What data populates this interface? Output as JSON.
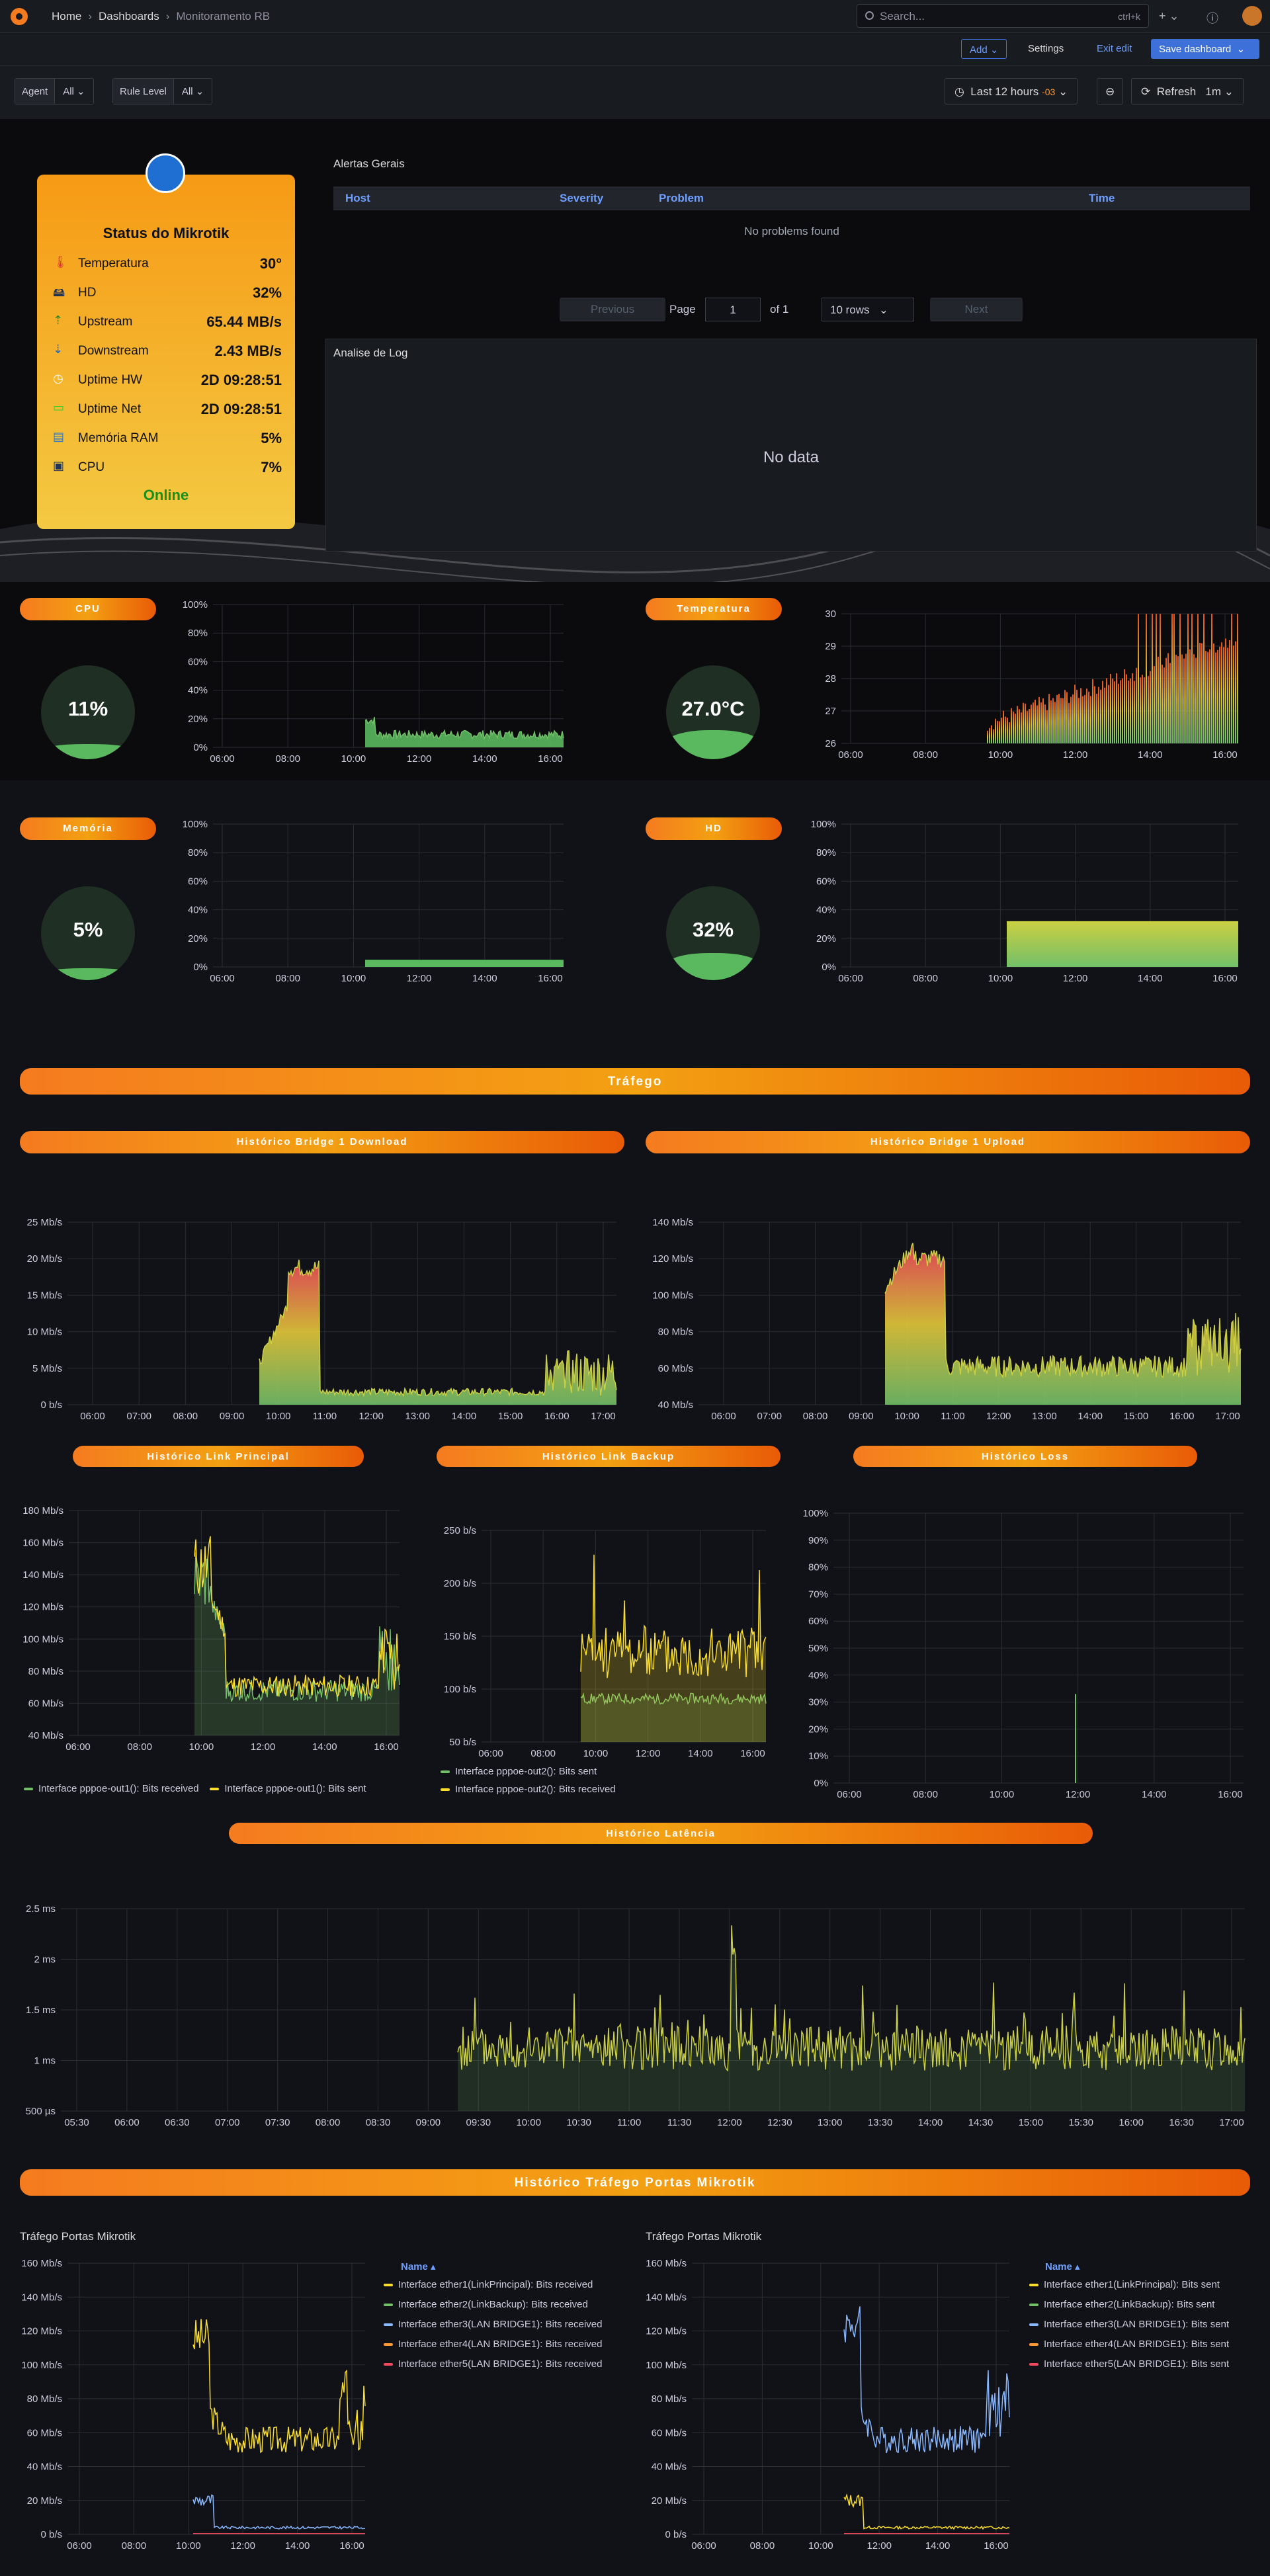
{
  "topbar": {
    "crumbs": [
      "Home",
      "Dashboards",
      "Monitoramento RB"
    ],
    "search_placeholder": "Search...",
    "search_shortcut": "ctrl+k"
  },
  "toolbar": {
    "add": "Add",
    "settings": "Settings",
    "exit_edit": "Exit edit",
    "save": "Save dashboard"
  },
  "vars": [
    {
      "label": "Agent",
      "value": "All"
    },
    {
      "label": "Rule Level",
      "value": "All"
    }
  ],
  "time": {
    "range": "Last 12 hours",
    "tz": "-03",
    "refresh": "Refresh",
    "interval": "1m"
  },
  "mikrotik": {
    "title": "Status do Mikrotik",
    "status": "Online",
    "rows": [
      {
        "key": "Temperatura",
        "value": "30°",
        "icon": "thermometer-icon"
      },
      {
        "key": "HD",
        "value": "32%",
        "icon": "disk-icon"
      },
      {
        "key": "Upstream",
        "value": "65.44 MB/s",
        "icon": "upload-icon"
      },
      {
        "key": "Downstream",
        "value": "2.43 MB/s",
        "icon": "download-icon"
      },
      {
        "key": "Uptime HW",
        "value": "2D 09:28:51",
        "icon": "clock-icon"
      },
      {
        "key": "Uptime Net",
        "value": "2D 09:28:51",
        "icon": "battery-icon"
      },
      {
        "key": "Memória RAM",
        "value": "5%",
        "icon": "memory-icon"
      },
      {
        "key": "CPU",
        "value": "7%",
        "icon": "cpu-icon"
      }
    ]
  },
  "alerts": {
    "title": "Alertas Gerais",
    "columns": [
      "Host",
      "Severity",
      "Problem",
      "Time"
    ],
    "empty": "No problems found",
    "prev": "Previous",
    "page_label": "Page",
    "page": "1",
    "of": "of 1",
    "rows": "10 rows",
    "next": "Next"
  },
  "log": {
    "title": "Analise de Log",
    "empty": "No data"
  },
  "pills": {
    "cpu": "CPU",
    "temp": "Temperatura",
    "mem": "Memória",
    "hd": "HD",
    "trafego": "Tráfego",
    "bridge_down": "Histórico Bridge 1 Download",
    "bridge_up": "Histórico Bridge 1 Upload",
    "link_principal": "Histórico Link Principal",
    "link_backup": "Histórico Link Backup",
    "loss": "Histórico Loss",
    "latencia": "Histórico Latência",
    "portas": "Histórico Tráfego Portas Mikrotik"
  },
  "gauges": {
    "cpu": "11%",
    "temp": "27.0°C",
    "mem": "5%",
    "hd": "32%",
    "cpu_level": 11,
    "temp_level": 35,
    "mem_level": 5,
    "hd_level": 32
  },
  "ports": {
    "title_left": "Tráfego Portas Mikrotik",
    "title_right": "Tráfego Portas Mikrotik",
    "name_header": "Name",
    "left": [
      "Interface ether1(LinkPrincipal): Bits received",
      "Interface ether2(LinkBackup): Bits received",
      "Interface ether3(LAN BRIDGE1): Bits received",
      "Interface ether4(LAN BRIDGE1): Bits received",
      "Interface ether5(LAN BRIDGE1): Bits received"
    ],
    "right": [
      "Interface ether1(LinkPrincipal): Bits sent",
      "Interface ether2(LinkBackup): Bits sent",
      "Interface ether3(LAN BRIDGE1): Bits sent",
      "Interface ether4(LAN BRIDGE1): Bits sent",
      "Interface ether5(LAN BRIDGE1): Bits sent"
    ],
    "colors": [
      "#fade2a",
      "#73bf69",
      "#8ab8ff",
      "#ff9830",
      "#f2495c"
    ]
  },
  "legends": {
    "link_principal": [
      "Interface pppoe-out1(): Bits received",
      "Interface pppoe-out1(): Bits sent"
    ],
    "link_backup": [
      "Interface pppoe-out2(): Bits sent",
      "Interface pppoe-out2(): Bits received"
    ]
  },
  "chart_data": [
    {
      "id": "cpu",
      "type": "area",
      "yticks": [
        "100%",
        "80%",
        "60%",
        "40%",
        "20%",
        "0%"
      ],
      "xticks": [
        "06:00",
        "08:00",
        "10:00",
        "12:00",
        "14:00",
        "16:00"
      ],
      "ylim": [
        0,
        100
      ],
      "x_start_frac": 0.48,
      "base": 9,
      "amp": 3
    },
    {
      "id": "temp",
      "type": "bar",
      "yticks": [
        "30",
        "29",
        "28",
        "27",
        "26"
      ],
      "xticks": [
        "06:00",
        "08:00",
        "10:00",
        "12:00",
        "14:00",
        "16:00"
      ],
      "ylim": [
        25.5,
        30
      ]
    },
    {
      "id": "mem",
      "type": "area",
      "yticks": [
        "100%",
        "80%",
        "60%",
        "40%",
        "20%",
        "0%"
      ],
      "xticks": [
        "06:00",
        "08:00",
        "10:00",
        "12:00",
        "14:00",
        "16:00"
      ],
      "ylim": [
        0,
        100
      ],
      "value": 5
    },
    {
      "id": "hd",
      "type": "area",
      "yticks": [
        "100%",
        "80%",
        "60%",
        "40%",
        "20%",
        "0%"
      ],
      "xticks": [
        "06:00",
        "08:00",
        "10:00",
        "12:00",
        "14:00",
        "16:00"
      ],
      "ylim": [
        0,
        100
      ],
      "value": 32
    },
    {
      "id": "bdown",
      "type": "area",
      "yticks": [
        "25 Mb/s",
        "20 Mb/s",
        "15 Mb/s",
        "10 Mb/s",
        "5 Mb/s",
        "0 b/s"
      ],
      "xticks": [
        "06:00",
        "07:00",
        "08:00",
        "09:00",
        "10:00",
        "11:00",
        "12:00",
        "13:00",
        "14:00",
        "15:00",
        "16:00",
        "17:00"
      ],
      "ylim": [
        0,
        27
      ]
    },
    {
      "id": "bup",
      "type": "area",
      "yticks": [
        "140 Mb/s",
        "120 Mb/s",
        "100 Mb/s",
        "80 Mb/s",
        "60 Mb/s",
        "40 Mb/s"
      ],
      "xticks": [
        "06:00",
        "07:00",
        "08:00",
        "09:00",
        "10:00",
        "11:00",
        "12:00",
        "13:00",
        "14:00",
        "15:00",
        "16:00",
        "17:00"
      ],
      "ylim": [
        35,
        150
      ]
    },
    {
      "id": "lprin",
      "type": "line",
      "yticks": [
        "180 Mb/s",
        "160 Mb/s",
        "140 Mb/s",
        "120 Mb/s",
        "100 Mb/s",
        "80 Mb/s",
        "60 Mb/s",
        "40 Mb/s"
      ],
      "xticks": [
        "06:00",
        "08:00",
        "10:00",
        "12:00",
        "14:00",
        "16:00"
      ],
      "ylim": [
        35,
        185
      ]
    },
    {
      "id": "lback",
      "type": "line",
      "yticks": [
        "250 b/s",
        "200 b/s",
        "150 b/s",
        "100 b/s",
        "50 b/s"
      ],
      "xticks": [
        "06:00",
        "08:00",
        "10:00",
        "12:00",
        "14:00",
        "16:00"
      ],
      "ylim": [
        20,
        275
      ]
    },
    {
      "id": "loss",
      "type": "line",
      "yticks": [
        "100%",
        "90%",
        "80%",
        "70%",
        "60%",
        "50%",
        "40%",
        "30%",
        "20%",
        "10%",
        "0%"
      ],
      "xticks": [
        "06:00",
        "08:00",
        "10:00",
        "12:00",
        "14:00",
        "16:00"
      ],
      "ylim": [
        0,
        100
      ]
    },
    {
      "id": "lat",
      "type": "line",
      "yticks": [
        "2.5 ms",
        "2 ms",
        "1.5 ms",
        "1 ms",
        "500 µs"
      ],
      "xticks": [
        "05:30",
        "06:00",
        "06:30",
        "07:00",
        "07:30",
        "08:00",
        "08:30",
        "09:00",
        "09:30",
        "10:00",
        "10:30",
        "11:00",
        "11:30",
        "12:00",
        "12:30",
        "13:00",
        "13:30",
        "14:00",
        "14:30",
        "15:00",
        "15:30",
        "16:00",
        "16:30",
        "17:00"
      ],
      "ylim": [
        0.3,
        2.65
      ]
    },
    {
      "id": "portL",
      "type": "line",
      "yticks": [
        "160 Mb/s",
        "140 Mb/s",
        "120 Mb/s",
        "100 Mb/s",
        "80 Mb/s",
        "60 Mb/s",
        "40 Mb/s",
        "20 Mb/s",
        "0 b/s"
      ],
      "xticks": [
        "06:00",
        "08:00",
        "10:00",
        "12:00",
        "14:00",
        "16:00"
      ],
      "ylim": [
        0,
        160
      ]
    },
    {
      "id": "portR",
      "type": "line",
      "yticks": [
        "160 Mb/s",
        "140 Mb/s",
        "120 Mb/s",
        "100 Mb/s",
        "80 Mb/s",
        "60 Mb/s",
        "40 Mb/s",
        "20 Mb/s",
        "0 b/s"
      ],
      "xticks": [
        "06:00",
        "08:00",
        "10:00",
        "12:00",
        "14:00",
        "16:00"
      ],
      "ylim": [
        0,
        160
      ]
    }
  ]
}
